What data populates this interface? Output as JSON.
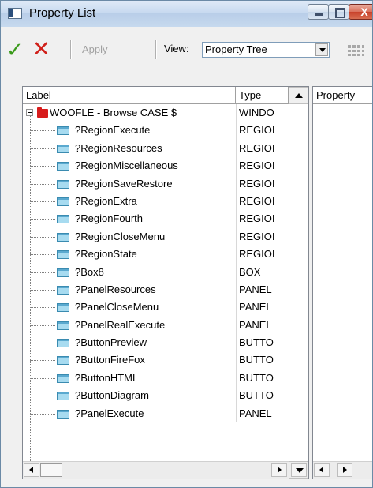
{
  "window": {
    "title": "Property List",
    "close_glyph": "X",
    "icons": {
      "app": "window-app-icon",
      "minimize": "minimize-icon",
      "maximize": "maximize-icon",
      "close": "close-icon"
    }
  },
  "toolbar": {
    "ok_icon": "✓",
    "cancel_icon": "✕",
    "apply_label": "Apply",
    "view_label": "View:",
    "view_value": "Property Tree",
    "colors": {
      "ok": "#3a9a1a",
      "cancel": "#d0201a"
    }
  },
  "tree": {
    "columns": {
      "label": "Label",
      "type": "Type"
    },
    "rows": [
      {
        "label": "WOOFLE - Browse CASE $",
        "type": "WINDO",
        "root": true
      },
      {
        "label": "?RegionExecute",
        "type": "REGIOI"
      },
      {
        "label": "?RegionResources",
        "type": "REGIOI"
      },
      {
        "label": "?RegionMiscellaneous",
        "type": "REGIOI"
      },
      {
        "label": "?RegionSaveRestore",
        "type": "REGIOI"
      },
      {
        "label": "?RegionExtra",
        "type": "REGIOI"
      },
      {
        "label": "?RegionFourth",
        "type": "REGIOI"
      },
      {
        "label": "?RegionCloseMenu",
        "type": "REGIOI"
      },
      {
        "label": "?RegionState",
        "type": "REGIOI"
      },
      {
        "label": "?Box8",
        "type": "BOX"
      },
      {
        "label": "?PanelResources",
        "type": "PANEL"
      },
      {
        "label": "?PanelCloseMenu",
        "type": "PANEL"
      },
      {
        "label": "?PanelRealExecute",
        "type": "PANEL"
      },
      {
        "label": "?ButtonPreview",
        "type": "BUTTO"
      },
      {
        "label": "?ButtonFireFox",
        "type": "BUTTO"
      },
      {
        "label": "?ButtonHTML",
        "type": "BUTTO"
      },
      {
        "label": "?ButtonDiagram",
        "type": "BUTTO"
      },
      {
        "label": "?PanelExecute",
        "type": "PANEL"
      }
    ]
  },
  "properties": {
    "column": "Property"
  }
}
